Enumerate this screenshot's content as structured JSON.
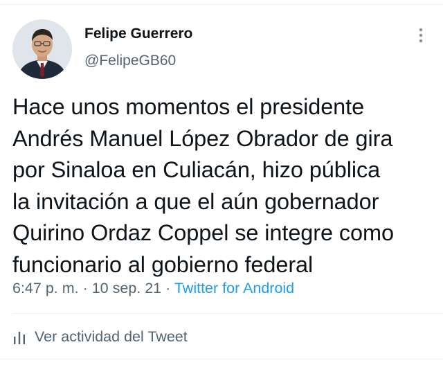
{
  "author": {
    "display_name": "Felipe Guerrero",
    "handle": "@FelipeGB60",
    "avatar_icon": "profile-photo"
  },
  "tweet": {
    "lines": [
      "Hace unos momentos el presidente",
      "Andrés Manuel López Obrador de gira",
      "por Sinaloa en Culiacán, hizo pública",
      "la invitación a que el aún gobernador",
      "Quirino Ordaz Coppel se integre como",
      "funcionario al gobierno federal"
    ]
  },
  "meta": {
    "time": "6:47 p. m.",
    "separator": " · ",
    "date": "10 sep. 21",
    "source": "Twitter for Android"
  },
  "actions": {
    "activity_label": "Ver actividad del Tweet",
    "activity_icon": "bar-chart-icon",
    "more_icon": "more-vertical-icon"
  },
  "colors": {
    "text_primary": "#0f1419",
    "text_secondary": "#536471",
    "link": "#1d9bf0",
    "divider": "#eff3f4"
  }
}
